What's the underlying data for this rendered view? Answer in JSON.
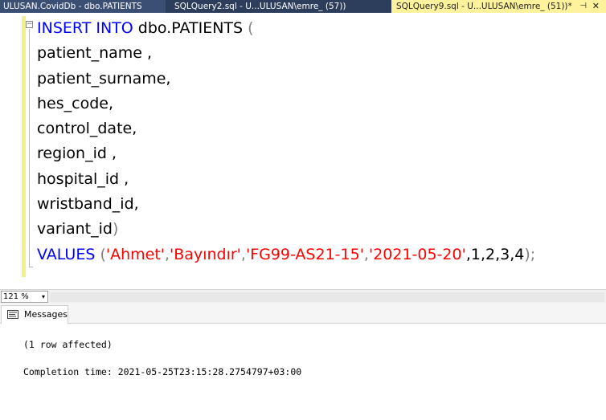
{
  "tabs": [
    {
      "label": "ULUSAN.CovidDb - dbo.PATIENTS"
    },
    {
      "label": "SQLQuery2.sql - U...ULUSAN\\emre_ (57))"
    },
    {
      "label": "SQLQuery9.sql - U...ULUSAN\\emre_ (51))*",
      "pin": "⊣",
      "close": "✕"
    }
  ],
  "editor": {
    "line1": {
      "kw": "INSERT INTO",
      "table": " dbo.PATIENTS ",
      "paren": "("
    },
    "columns": [
      "patient_name ,",
      "patient_surname,",
      "hes_code,",
      "control_date,",
      "region_id ,",
      "hospital_id ,",
      "wristband_id,"
    ],
    "last_col": {
      "name": "variant_id",
      "paren": ")"
    },
    "values_line": {
      "kw": "VALUES",
      "open": " (",
      "s1": "'Ahmet'",
      "c1": ",",
      "s2": "'Bayındır'",
      "c2": ",",
      "s3": "'FG99-AS21-15'",
      "c3": ",",
      "s4": "'2021-05-20'",
      "nums": ",1,2,3,4",
      "close": ");"
    }
  },
  "zoom": {
    "value": "121 %",
    "arrow": "▾"
  },
  "results": {
    "tab_label": "Messages",
    "lines": [
      "(1 row affected)",
      "Completion time: 2021-05-25T23:15:28.2754797+03:00"
    ]
  }
}
